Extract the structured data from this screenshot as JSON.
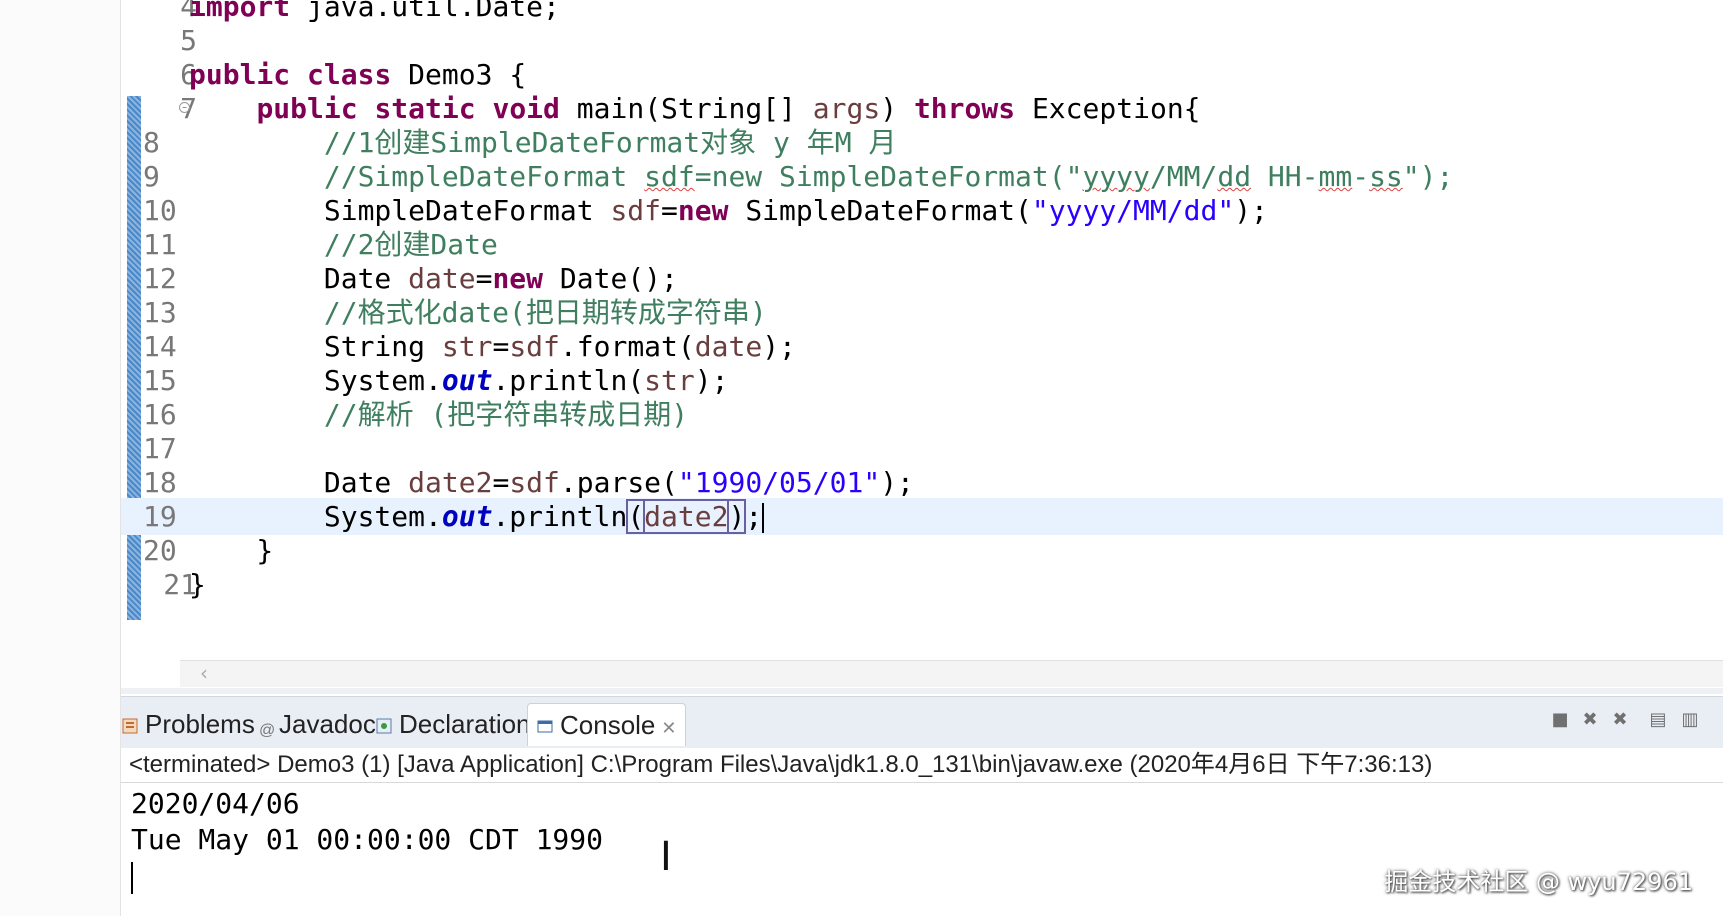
{
  "editor": {
    "lines": [
      {
        "num": "4",
        "parts": [
          {
            "t": "import ",
            "c": "kw"
          },
          {
            "t": "java.util.Date;"
          }
        ]
      },
      {
        "num": "5",
        "parts": []
      },
      {
        "num": "6",
        "parts": [
          {
            "t": "public ",
            "c": "kw"
          },
          {
            "t": "class ",
            "c": "kw"
          },
          {
            "t": "Demo3 {"
          }
        ]
      },
      {
        "num": "7",
        "fold": true,
        "parts": [
          {
            "t": "    "
          },
          {
            "t": "public ",
            "c": "kw"
          },
          {
            "t": "static ",
            "c": "kw"
          },
          {
            "t": "void ",
            "c": "kw"
          },
          {
            "t": "main(String[] "
          },
          {
            "t": "args",
            "c": "vr"
          },
          {
            "t": ") "
          },
          {
            "t": "throws ",
            "c": "kw"
          },
          {
            "t": "Exception{"
          }
        ]
      },
      {
        "num": "8",
        "mod": true,
        "parts": [
          {
            "t": "        "
          },
          {
            "t": "//1创建SimpleDateFormat对象 y 年M 月",
            "c": "cm"
          }
        ]
      },
      {
        "num": "9",
        "mod": true,
        "parts": [
          {
            "t": "        "
          },
          {
            "t": "//SimpleDateFormat ",
            "c": "cm"
          },
          {
            "t": "sdf",
            "c": "cm sq"
          },
          {
            "t": "=new SimpleDateFormat(\"",
            "c": "cm"
          },
          {
            "t": "yyyy",
            "c": "cm sq"
          },
          {
            "t": "/MM/",
            "c": "cm"
          },
          {
            "t": "dd",
            "c": "cm sq"
          },
          {
            "t": " HH-",
            "c": "cm"
          },
          {
            "t": "mm",
            "c": "cm sq"
          },
          {
            "t": "-",
            "c": "cm"
          },
          {
            "t": "ss",
            "c": "cm sq"
          },
          {
            "t": "\");",
            "c": "cm"
          }
        ]
      },
      {
        "num": "10",
        "mod": true,
        "parts": [
          {
            "t": "        SimpleDateFormat "
          },
          {
            "t": "sdf",
            "c": "vr"
          },
          {
            "t": "="
          },
          {
            "t": "new ",
            "c": "kw"
          },
          {
            "t": "SimpleDateFormat("
          },
          {
            "t": "\"yyyy/MM/dd\"",
            "c": "st"
          },
          {
            "t": ");"
          }
        ]
      },
      {
        "num": "11",
        "mod": true,
        "parts": [
          {
            "t": "        "
          },
          {
            "t": "//2创建Date",
            "c": "cm"
          }
        ]
      },
      {
        "num": "12",
        "mod": true,
        "parts": [
          {
            "t": "        Date "
          },
          {
            "t": "date",
            "c": "vr"
          },
          {
            "t": "="
          },
          {
            "t": "new ",
            "c": "kw"
          },
          {
            "t": "Date();"
          }
        ]
      },
      {
        "num": "13",
        "mod": true,
        "parts": [
          {
            "t": "        "
          },
          {
            "t": "//格式化date(把日期转成字符串)",
            "c": "cm"
          }
        ]
      },
      {
        "num": "14",
        "mod": true,
        "parts": [
          {
            "t": "        String "
          },
          {
            "t": "str",
            "c": "vr"
          },
          {
            "t": "="
          },
          {
            "t": "sdf",
            "c": "vr"
          },
          {
            "t": ".format("
          },
          {
            "t": "date",
            "c": "vr"
          },
          {
            "t": ");"
          }
        ]
      },
      {
        "num": "15",
        "mod": true,
        "parts": [
          {
            "t": "        System."
          },
          {
            "t": "out",
            "c": "fd"
          },
          {
            "t": ".println("
          },
          {
            "t": "str",
            "c": "vr"
          },
          {
            "t": ");"
          }
        ]
      },
      {
        "num": "16",
        "mod": true,
        "parts": [
          {
            "t": "        "
          },
          {
            "t": "//解析 (把字符串转成日期)",
            "c": "cm"
          }
        ]
      },
      {
        "num": "17",
        "mod": true,
        "parts": []
      },
      {
        "num": "18",
        "mod": true,
        "parts": [
          {
            "t": "        Date "
          },
          {
            "t": "date2",
            "c": "vr"
          },
          {
            "t": "="
          },
          {
            "t": "sdf",
            "c": "vr"
          },
          {
            "t": ".parse("
          },
          {
            "t": "\"1990/05/01\"",
            "c": "st"
          },
          {
            "t": ");"
          }
        ]
      },
      {
        "num": "19",
        "mod": true,
        "current": true,
        "parts": [
          {
            "t": "        System."
          },
          {
            "t": "out",
            "c": "fd"
          },
          {
            "t": ".println"
          },
          {
            "t": "(",
            "c": "bx"
          },
          {
            "t": "date2",
            "c": "vr bx"
          },
          {
            "t": ")",
            "c": "bx"
          },
          {
            "t": ";"
          },
          {
            "caret": true
          }
        ]
      },
      {
        "num": "20",
        "mod": true,
        "parts": [
          {
            "t": "    }"
          }
        ]
      },
      {
        "num": "21",
        "parts": [
          {
            "t": "}"
          }
        ]
      }
    ]
  },
  "panel": {
    "tabs": [
      {
        "label": "Problems",
        "icon": "problems-icon",
        "active": false
      },
      {
        "label": "Javadoc",
        "icon": "javadoc-icon",
        "active": false
      },
      {
        "label": "Declaration",
        "icon": "declaration-icon",
        "active": false
      },
      {
        "label": "Console",
        "icon": "console-icon",
        "active": true
      }
    ],
    "close_glyph": "✕",
    "terminated": "<terminated> Demo3 (1) [Java Application] C:\\Program Files\\Java\\jdk1.8.0_131\\bin\\javaw.exe (2020年4月6日 下午7:36:13)",
    "output": [
      "2020/04/06",
      "Tue May 01 00:00:00 CDT 1990"
    ]
  },
  "watermark": "掘金技术社区 @ wyu72961"
}
